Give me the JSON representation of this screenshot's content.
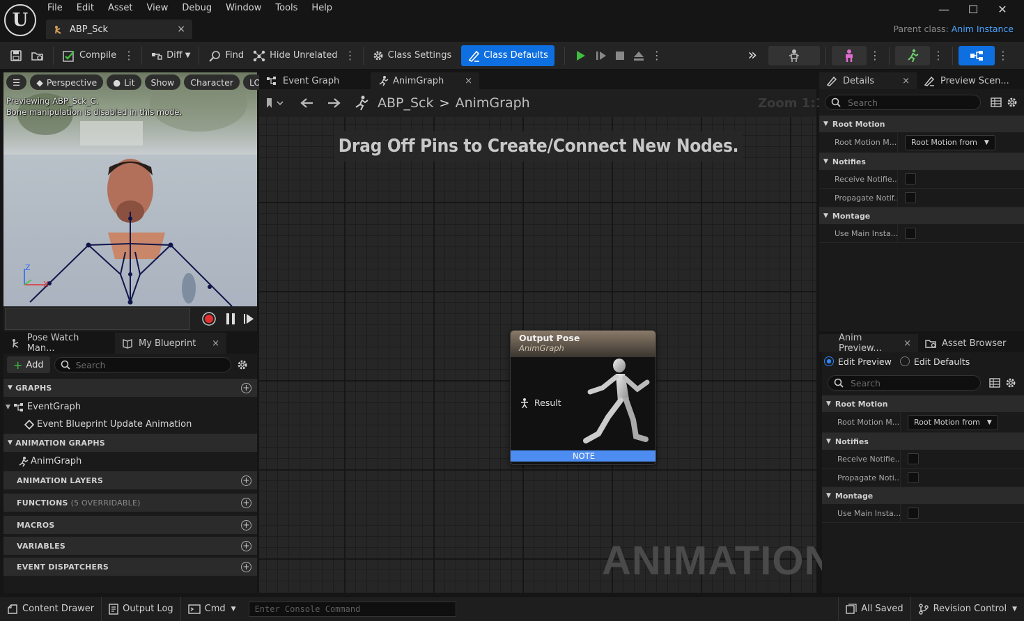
{
  "menu": [
    "File",
    "Edit",
    "Asset",
    "View",
    "Debug",
    "Window",
    "Tools",
    "Help"
  ],
  "asset_tab": {
    "label": "ABP_Sck",
    "close": "×"
  },
  "parent_class": {
    "label": "Parent class:",
    "value": "Anim Instance"
  },
  "window_controls": {
    "minimize": "—",
    "maximize": "☐",
    "close": "✕"
  },
  "toolbar": {
    "compile": "Compile",
    "diff": "Diff",
    "find": "Find",
    "hide_unrelated": "Hide Unrelated",
    "class_settings": "Class Settings",
    "class_defaults": "Class Defaults",
    "more": "⋮",
    "overflow": "»"
  },
  "viewport": {
    "buttons": {
      "menu": "☰",
      "perspective": "Perspective",
      "lit": "Lit",
      "show": "Show",
      "character": "Character",
      "lod": "LO"
    },
    "message_line1": "Previewing ABP_Sck_C.",
    "message_line2": "Bone manipulation is disabled in this mode.",
    "axis": {
      "z": "Z",
      "x": "X"
    }
  },
  "left_panel": {
    "tabs": [
      {
        "label": "Pose Watch Man..."
      },
      {
        "label": "My Blueprint",
        "close": "×"
      }
    ],
    "add_label": "Add",
    "search_placeholder": "Search",
    "graphs": "GRAPHS",
    "event_graph": "EventGraph",
    "event_update": "Event Blueprint Update Animation",
    "animation_graphs": "ANIMATION GRAPHS",
    "anim_graph": "AnimGraph",
    "animation_layers": "ANIMATION LAYERS",
    "functions": "FUNCTIONS",
    "functions_sub": "(5 OVERRIDABLE)",
    "macros": "MACROS",
    "variables": "VARIABLES",
    "event_dispatchers": "EVENT DISPATCHERS",
    "plus": "+"
  },
  "graph_tabs": [
    {
      "label": "Event Graph"
    },
    {
      "label": "AnimGraph",
      "close": "×"
    }
  ],
  "graph": {
    "breadcrumb_root": "ABP_Sck",
    "breadcrumb_sep": ">",
    "breadcrumb_leaf": "AnimGraph",
    "zoom": "Zoom 1:1",
    "hint": "Drag Off Pins to Create/Connect New Nodes.",
    "watermark": "ANIMATION",
    "node": {
      "title": "Output Pose",
      "subtitle": "AnimGraph",
      "pin": "Result",
      "note": "NOTE"
    }
  },
  "details": {
    "tabs": [
      {
        "label": "Details",
        "close": "×"
      },
      {
        "label": "Preview Scen..."
      }
    ],
    "search_placeholder": "Search",
    "sections": [
      {
        "title": "Root Motion",
        "rows": [
          {
            "name": "Root Motion M...",
            "value": "Root Motion from",
            "type": "dropdown"
          }
        ]
      },
      {
        "title": "Notifies",
        "rows": [
          {
            "name": "Receive Notifie...",
            "type": "checkbox"
          },
          {
            "name": "Propagate Notif...",
            "type": "checkbox"
          }
        ]
      },
      {
        "title": "Montage",
        "rows": [
          {
            "name": "Use Main Insta...",
            "type": "checkbox"
          }
        ]
      }
    ]
  },
  "preview": {
    "tabs": [
      {
        "label": "Anim Preview...",
        "close": "×"
      },
      {
        "label": "Asset Browser"
      }
    ],
    "edit_preview": "Edit Preview",
    "edit_defaults": "Edit Defaults",
    "search_placeholder": "Search",
    "sections": [
      {
        "title": "Root Motion",
        "rows": [
          {
            "name": "Root Motion M...",
            "value": "Root Motion from",
            "type": "dropdown"
          }
        ]
      },
      {
        "title": "Notifies",
        "rows": [
          {
            "name": "Receive Notifie...",
            "type": "checkbox"
          },
          {
            "name": "Propagate Noti...",
            "type": "checkbox"
          }
        ]
      },
      {
        "title": "Montage",
        "rows": [
          {
            "name": "Use Main Insta...",
            "type": "checkbox"
          }
        ]
      }
    ]
  },
  "statusbar": {
    "content_drawer": "Content Drawer",
    "output_log": "Output Log",
    "cmd": "Cmd",
    "console_placeholder": "Enter Console Command",
    "all_saved": "All Saved",
    "revision_control": "Revision Control"
  },
  "colors": {
    "accent": "#0e6fe0",
    "link": "#4aa2ff",
    "note": "#4d8cf0",
    "play": "#3fbf3f",
    "record": "#e03030"
  }
}
